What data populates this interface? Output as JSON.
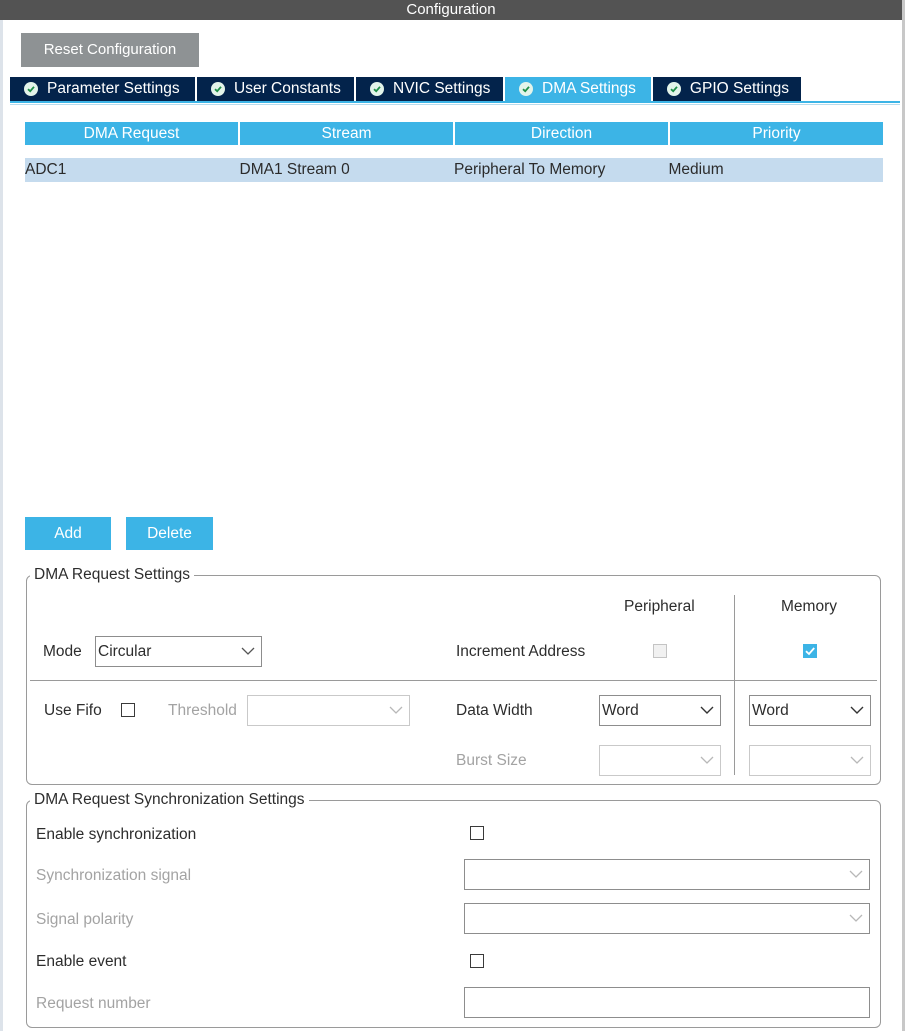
{
  "window": {
    "title": "Configuration"
  },
  "toolbar": {
    "reset_label": "Reset Configuration"
  },
  "tabs": [
    {
      "label": "Parameter Settings",
      "active": false
    },
    {
      "label": "User Constants",
      "active": false
    },
    {
      "label": "NVIC Settings",
      "active": false
    },
    {
      "label": "DMA Settings",
      "active": true
    },
    {
      "label": "GPIO Settings",
      "active": false
    }
  ],
  "dma_table": {
    "columns": [
      "DMA Request",
      "Stream",
      "Direction",
      "Priority"
    ],
    "rows": [
      {
        "request": "ADC1",
        "stream": "DMA1 Stream 0",
        "direction": "Peripheral To Memory",
        "priority": "Medium"
      }
    ]
  },
  "actions": {
    "add_label": "Add",
    "delete_label": "Delete"
  },
  "request_settings": {
    "legend": "DMA Request Settings",
    "peripheral_header": "Peripheral",
    "memory_header": "Memory",
    "mode_label": "Mode",
    "mode_value": "Circular",
    "increment_label": "Increment Address",
    "increment_peripheral": false,
    "increment_memory": true,
    "use_fifo_label": "Use Fifo",
    "use_fifo": false,
    "threshold_label": "Threshold",
    "threshold_value": "",
    "data_width_label": "Data Width",
    "data_width_peripheral": "Word",
    "data_width_memory": "Word",
    "burst_size_label": "Burst Size",
    "burst_peripheral": "",
    "burst_memory": ""
  },
  "sync_settings": {
    "legend": "DMA Request Synchronization Settings",
    "enable_sync_label": "Enable synchronization",
    "enable_sync": false,
    "sync_signal_label": "Synchronization signal",
    "sync_signal_value": "",
    "polarity_label": "Signal polarity",
    "polarity_value": "",
    "enable_event_label": "Enable event",
    "enable_event": false,
    "request_number_label": "Request number",
    "request_number_value": ""
  },
  "colors": {
    "accent": "#3cb4e6",
    "tab_dark": "#03234b",
    "row_selected": "#c5dbee",
    "button_gray": "#8e9294",
    "titlebar": "#535353"
  }
}
